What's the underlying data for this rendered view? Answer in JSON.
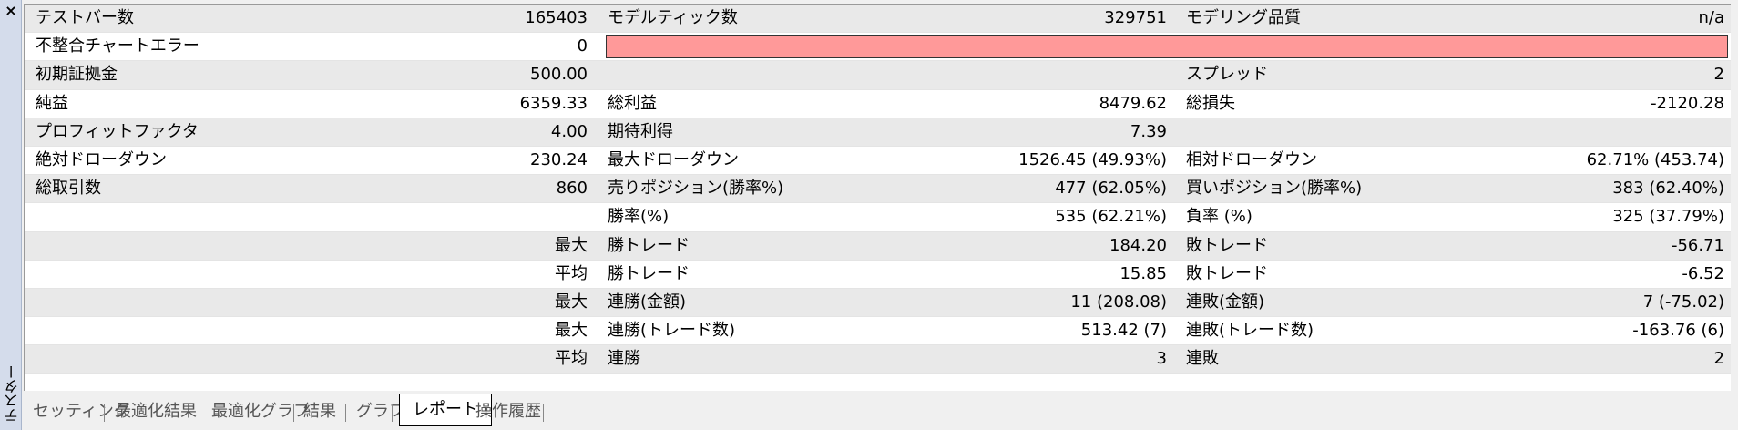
{
  "panel": {
    "close_glyph": "×",
    "title": "テスター"
  },
  "report": {
    "rows": [
      {
        "c1": "テストバー数",
        "v1": "165403",
        "c2": "モデルティック数",
        "v2": "329751",
        "c3": "モデリング品質",
        "v3": "n/a"
      },
      {
        "c1": "不整合チャートエラー",
        "v1": "0",
        "bar": true,
        "bar_color": "#ff9999"
      },
      {
        "c1": "初期証拠金",
        "v1": "500.00",
        "c3": "スプレッド",
        "v3": "2"
      },
      {
        "c1": "純益",
        "v1": "6359.33",
        "c2": "総利益",
        "v2": "8479.62",
        "c3": "総損失",
        "v3": "-2120.28"
      },
      {
        "c1": "プロフィットファクタ",
        "v1": "4.00",
        "c2": "期待利得",
        "v2": "7.39"
      },
      {
        "c1": "絶対ドローダウン",
        "v1": "230.24",
        "c2": "最大ドローダウン",
        "v2": "1526.45 (49.93%)",
        "c3": "相対ドローダウン",
        "v3": "62.71% (453.74)"
      },
      {
        "c1": "総取引数",
        "v1": "860",
        "c2": "売りポジション(勝率%)",
        "v2": "477 (62.05%)",
        "c3": "買いポジション(勝率%)",
        "v3": "383 (62.40%)"
      },
      {
        "c2": "勝率(%)",
        "v2": "535 (62.21%)",
        "c3": "負率 (%)",
        "v3": "325 (37.79%)"
      },
      {
        "v1": "最大",
        "c2": "勝トレード",
        "v2": "184.20",
        "c3": "敗トレード",
        "v3": "-56.71"
      },
      {
        "v1": "平均",
        "c2": "勝トレード",
        "v2": "15.85",
        "c3": "敗トレード",
        "v3": "-6.52"
      },
      {
        "v1": "最大",
        "c2": "連勝(金額)",
        "v2": "11 (208.08)",
        "c3": "連敗(金額)",
        "v3": "7 (-75.02)"
      },
      {
        "v1": "最大",
        "c2": "連勝(トレード数)",
        "v2": "513.42 (7)",
        "c3": "連敗(トレード数)",
        "v3": "-163.76 (6)"
      },
      {
        "v1": "平均",
        "c2": "連勝",
        "v2": "3",
        "c3": "連敗",
        "v3": "2"
      }
    ]
  },
  "tabs": [
    {
      "label": "セッティング",
      "active": false
    },
    {
      "label": "最適化結果",
      "active": false
    },
    {
      "label": "最適化グラフ",
      "active": false
    },
    {
      "label": "結果",
      "active": false
    },
    {
      "label": "グラフ",
      "active": false
    },
    {
      "label": "レポート",
      "active": true
    },
    {
      "label": "操作履歴",
      "active": false
    }
  ]
}
